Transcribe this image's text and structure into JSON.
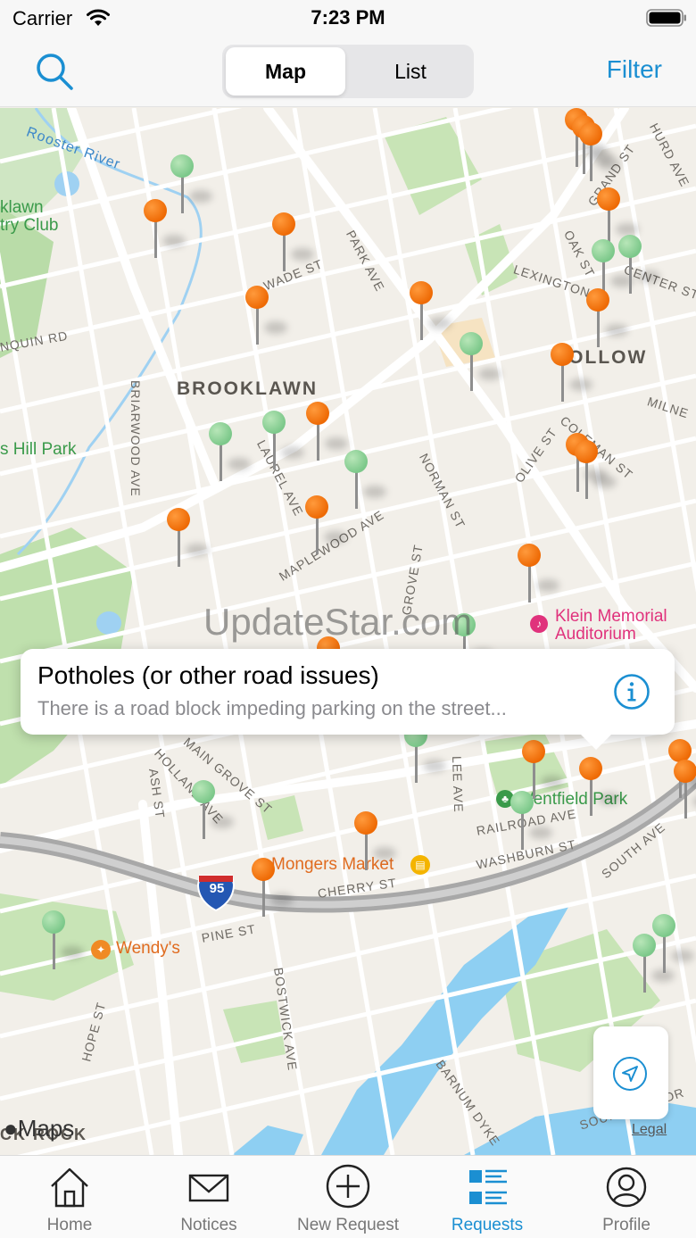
{
  "status_bar": {
    "carrier": "Carrier",
    "time": "7:23 PM"
  },
  "nav": {
    "segments": [
      "Map",
      "List"
    ],
    "selected_segment": "Map",
    "filter_label": "Filter",
    "accent_color": "#1b8fd2"
  },
  "map": {
    "labels": {
      "rooster_river": "Rooster River",
      "country_club": "klawn\ntry Club",
      "algonquin": "NQUIN RD",
      "brooklawn": "BROOKLAWN",
      "briarwood": "BRIARWOOD AVE",
      "laurel": "LAUREL AVE",
      "park": "PARK AVE",
      "wade": "WADE ST",
      "hill_park": "s Hill Park",
      "maplewood": "MAPLEWOOD AVE",
      "grove": "GROVE ST",
      "norman": "NORMAN ST",
      "lexington": "LEXINGTON",
      "hollow": "HOLLOW",
      "milne": "MILNE",
      "coleman": "COLEMAN ST",
      "olive": "OLIVE ST",
      "oak": "OAK ST",
      "grand": "GRAND ST",
      "hurd": "HURD AVE",
      "center": "CENTER ST",
      "klein": "Klein Memorial\nAuditorium",
      "wentfield": "Wentfield Park",
      "railroad": "RAILROAD AVE",
      "washburn": "WASHBURN ST",
      "south": "SOUTH AVE",
      "cherry": "CHERRY ST",
      "mongers": "Mongers Market",
      "i95": "95",
      "pine": "PINE ST",
      "wendys": "Wendy's",
      "bostwick": "BOSTWICK AVE",
      "ash": "ASH ST",
      "holland": "HOLLAND AVE",
      "main_grove": "MAIN GROVE ST",
      "lee": "LEE AVE",
      "barnum": "BARNUM DYKE",
      "hope": "HOPE ST",
      "soundview": "SOUNDVIEW DR",
      "black_rock": "CK ROCK"
    },
    "watermark": "UpdateStar.com",
    "callout": {
      "title": "Potholes (or other road issues)",
      "subtitle": "There is a road block impeding parking on the street..."
    },
    "maps_logo": "Maps",
    "legal": "Legal",
    "pin_colors": {
      "open": "#ee6a05",
      "closed": "#7cc88a"
    }
  },
  "tabs": [
    {
      "label": "Home",
      "icon": "home-icon"
    },
    {
      "label": "Notices",
      "icon": "envelope-icon"
    },
    {
      "label": "New Request",
      "icon": "plus-circle-icon"
    },
    {
      "label": "Requests",
      "icon": "list-icon"
    },
    {
      "label": "Profile",
      "icon": "person-circle-icon"
    }
  ],
  "active_tab": "Requests"
}
